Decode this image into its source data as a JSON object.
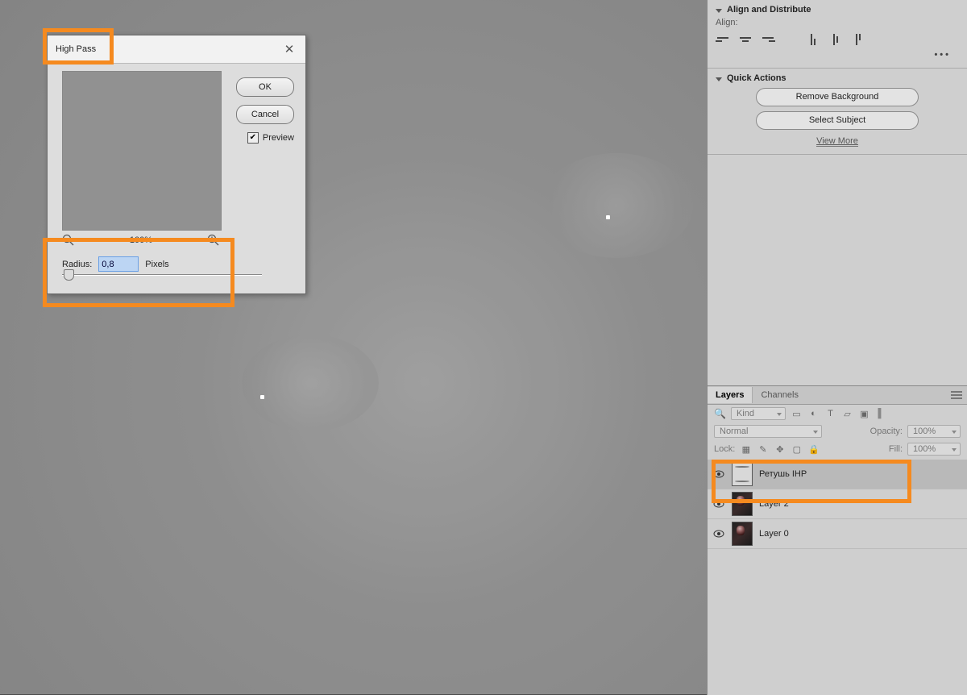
{
  "dialog": {
    "title": "High Pass",
    "ok": "OK",
    "cancel": "Cancel",
    "preview_label": "Preview",
    "preview_checked": true,
    "zoom": "100%",
    "radius_label": "Radius:",
    "radius_value": "0,8",
    "radius_unit": "Pixels"
  },
  "properties": {
    "align_section": "Align and Distribute",
    "align_label": "Align:",
    "quick_actions": "Quick Actions",
    "remove_bg": "Remove Background",
    "select_subject": "Select Subject",
    "view_more": "View More"
  },
  "layers_panel": {
    "tab_layers": "Layers",
    "tab_channels": "Channels",
    "filter_kind": "Kind",
    "blend_mode": "Normal",
    "opacity_label": "Opacity:",
    "opacity_value": "100%",
    "lock_label": "Lock:",
    "fill_label": "Fill:",
    "fill_value": "100%",
    "layers": [
      {
        "name": "Ретушь IHP",
        "selected": true,
        "thumb": "hp"
      },
      {
        "name": "Layer 2",
        "selected": false,
        "thumb": "photo"
      },
      {
        "name": "Layer 0",
        "selected": false,
        "thumb": "photo"
      }
    ]
  }
}
